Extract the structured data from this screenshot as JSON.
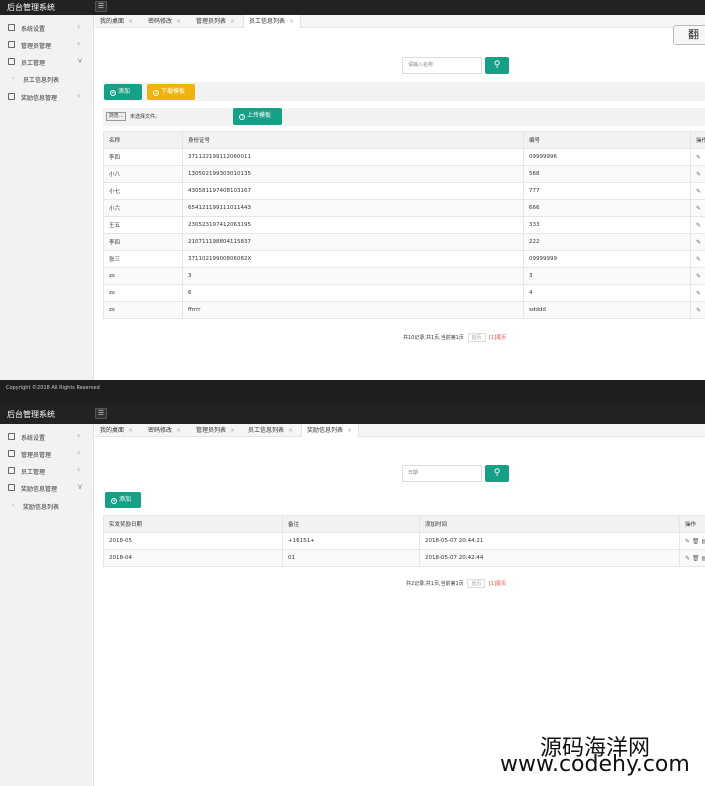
{
  "app": {
    "title": "后台管理系统",
    "menu_toggle_icon": "☰"
  },
  "sidebar1": {
    "items": [
      {
        "label": "系统设置",
        "chevron": "‹"
      },
      {
        "label": "管理员管理",
        "chevron": "‹"
      },
      {
        "label": "员工管理",
        "chevron": "∨"
      },
      {
        "label": "奖励信息管理",
        "chevron": "‹"
      }
    ],
    "sub": {
      "arrow": "›",
      "label": "员工信息列表"
    }
  },
  "tabs1": [
    {
      "label": "我的桌面"
    },
    {
      "label": "密码修改"
    },
    {
      "label": "管理员列表"
    },
    {
      "label": "员工信息列表"
    }
  ],
  "tab_close": "×",
  "side_button": {
    "label": "翻"
  },
  "search1": {
    "placeholder": "请输入名称",
    "icon": "⚲"
  },
  "actions1": {
    "add": "添加",
    "download": "下载模板"
  },
  "upload": {
    "browse": "浏览...",
    "no_file": "未选择文件。",
    "upload": "上传模板"
  },
  "employee_table": {
    "headers": [
      "名称",
      "身份证号",
      "编号",
      "操作"
    ],
    "rows": [
      [
        "李四",
        "371122199112060011",
        "09999996"
      ],
      [
        "小八",
        "130502199303010135",
        "568"
      ],
      [
        "小七",
        "430581197408103167",
        "777"
      ],
      [
        "小六",
        "654121199111011443",
        "666"
      ],
      [
        "王五",
        "230523197412063195",
        "333"
      ],
      [
        "李四",
        "210711198804115837",
        "222"
      ],
      [
        "张三",
        "37110219900806082X",
        "09999999"
      ],
      [
        "zs",
        "3",
        "3"
      ],
      [
        "zs",
        "6",
        "4"
      ],
      [
        "zs",
        "ffrrrr",
        "sdddd"
      ]
    ],
    "edit_icon": "✎"
  },
  "pager1": {
    "summary": "共10记录,共1页,当前第1页",
    "first": "首页",
    "last": "[1]尾页"
  },
  "footer": {
    "text": "Copyright ©2018 All Rights Reserved"
  },
  "sidebar2": {
    "items": [
      {
        "label": "系统设置",
        "chevron": "‹"
      },
      {
        "label": "管理员管理",
        "chevron": "‹"
      },
      {
        "label": "员工管理",
        "chevron": "‹"
      },
      {
        "label": "奖励信息管理",
        "chevron": "∨"
      }
    ],
    "sub": {
      "arrow": "›",
      "label": "奖励信息列表"
    }
  },
  "tabs2": [
    {
      "label": "我的桌面"
    },
    {
      "label": "密码修改"
    },
    {
      "label": "管理员列表"
    },
    {
      "label": "员工信息列表"
    },
    {
      "label": "奖励信息列表"
    }
  ],
  "search2": {
    "placeholder": "日期",
    "icon": "⚲"
  },
  "actions2": {
    "add": "添加"
  },
  "reward_table": {
    "headers": [
      "实发奖励日期",
      "备注",
      "添加时间",
      "操作"
    ],
    "rows": [
      [
        "2018-05",
        "+16151+",
        "2018-05-07 20:44:21"
      ],
      [
        "2018-04",
        "01",
        "2018-05-07 20:42:44"
      ]
    ],
    "ops_icons": "✎ 🗑 ▤"
  },
  "pager2": {
    "summary": "共2记录,共1页,当前第1页",
    "first": "首页",
    "last": "[1]尾页"
  },
  "watermark": {
    "line1": "源码海洋网",
    "line2": "www.codehy.com"
  }
}
